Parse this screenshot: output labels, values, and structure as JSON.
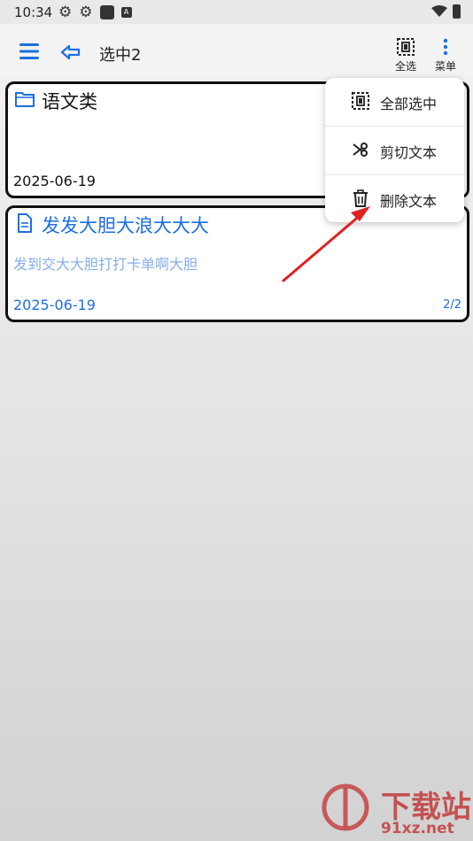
{
  "status_bar": {
    "time": "10:34",
    "badge": "A"
  },
  "toolbar": {
    "title": "选中2",
    "select_all_label": "全选",
    "menu_label": "菜单"
  },
  "cards": [
    {
      "type": "folder",
      "title": "语文类",
      "date": "2025-06-19"
    },
    {
      "type": "file",
      "title": "发发大胆大浪大大大",
      "preview": "发到交大大胆打打卡单啊大胆",
      "date": "2025-06-19",
      "count": "2/2"
    }
  ],
  "context_menu": {
    "items": [
      {
        "label": "全部选中",
        "icon": "select-all-icon"
      },
      {
        "label": "剪切文本",
        "icon": "scissors-icon"
      },
      {
        "label": "删除文本",
        "icon": "trash-icon"
      }
    ]
  },
  "watermark": {
    "brand": "下载站",
    "site": "91xz.net"
  },
  "colors": {
    "accent": "#1c6fe0",
    "preview": "#84aee9",
    "card_border": "#111111",
    "arrow": "#e02020",
    "watermark": "#c23b3b"
  }
}
